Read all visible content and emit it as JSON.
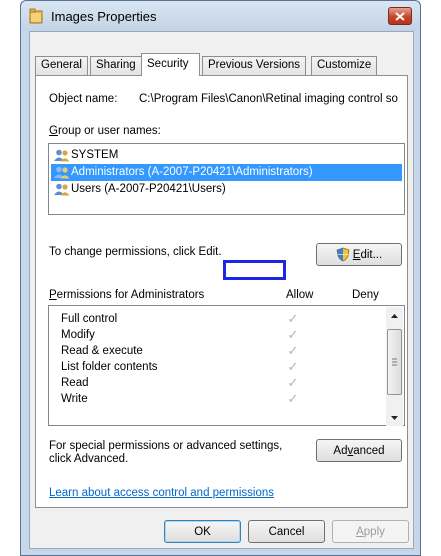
{
  "window": {
    "title": "Images Properties",
    "close_icon": "close-icon"
  },
  "tabs": [
    {
      "label": "General"
    },
    {
      "label": "Sharing"
    },
    {
      "label": "Security",
      "active": true
    },
    {
      "label": "Previous Versions"
    },
    {
      "label": "Customize"
    }
  ],
  "object": {
    "label": "Object name:",
    "value": "C:\\Program Files\\Canon\\Retinal imaging control so"
  },
  "groups": {
    "label_pre": "",
    "label_u": "G",
    "label_post": "roup or user names:",
    "items": [
      {
        "name": "SYSTEM",
        "selected": false
      },
      {
        "name": "Administrators (A-2007-P20421\\Administrators)",
        "selected": true
      },
      {
        "name": "Users (A-2007-P20421\\Users)",
        "selected": false
      }
    ]
  },
  "change": {
    "text": "To change permissions, click Edit.",
    "edit_pre": "",
    "edit_u": "E",
    "edit_post": "dit..."
  },
  "permissions": {
    "label_pre": "",
    "label_u": "P",
    "label_post": "ermissions for Administrators",
    "allow_header": "Allow",
    "deny_header": "Deny",
    "rows": [
      {
        "name": "Full control",
        "allow": true,
        "deny": false
      },
      {
        "name": "Modify",
        "allow": true,
        "deny": false
      },
      {
        "name": "Read & execute",
        "allow": true,
        "deny": false
      },
      {
        "name": "List folder contents",
        "allow": true,
        "deny": false
      },
      {
        "name": "Read",
        "allow": true,
        "deny": false
      },
      {
        "name": "Write",
        "allow": true,
        "deny": false
      }
    ]
  },
  "special": {
    "text_line1": "For special permissions or advanced settings,",
    "text_line2": "click Advanced.",
    "advanced_pre": "Ad",
    "advanced_u": "v",
    "advanced_post": "anced"
  },
  "learn_link": "Learn about access control and permissions",
  "buttons": {
    "ok": "OK",
    "cancel": "Cancel",
    "apply_pre": "",
    "apply_u": "A",
    "apply_post": "pply"
  },
  "colors": {
    "selection": "#3399ff",
    "highlight_box": "#1b26e6",
    "link": "#0066cc"
  }
}
